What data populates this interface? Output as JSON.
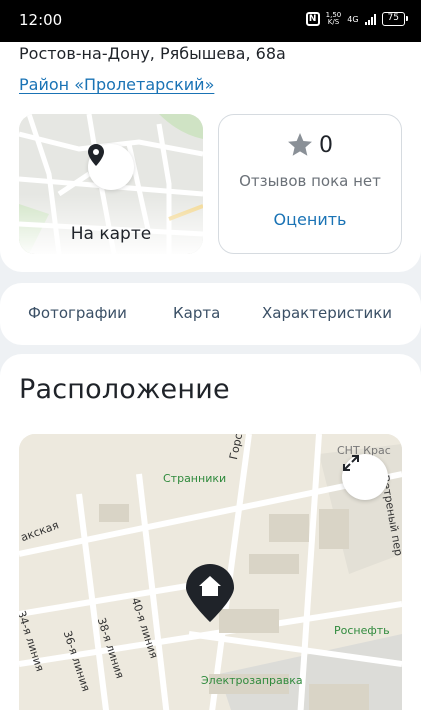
{
  "status_bar": {
    "time": "12:00",
    "speed_value": "1,50",
    "speed_unit": "K/S",
    "network": "4G",
    "battery": "75"
  },
  "listing": {
    "address": "Ростов-на-Дону, Рябышева, 68а",
    "district": "Район «Пролетарский»"
  },
  "map_preview": {
    "label": "На карте"
  },
  "reviews": {
    "count": "0",
    "empty_text": "Отзывов пока нет",
    "rate_label": "Оценить"
  },
  "tabs": [
    {
      "label": "Фотографии"
    },
    {
      "label": "Карта"
    },
    {
      "label": "Характеристики"
    }
  ],
  "location": {
    "title": "Расположение",
    "map_labels": {
      "poi_1": "Странники",
      "poi_2": "Роснефть",
      "poi_3": "Электрозаправка",
      "snt": "СНТ Крас",
      "street_gorsk": "Горсо",
      "street_vetr": "Ветреный пер",
      "street_aksk": "акская",
      "street_34": "34-я линия",
      "street_36": "36-я линия",
      "street_38": "38-я линия",
      "street_40": "40-я линия"
    }
  },
  "colors": {
    "accent": "#1a73b5",
    "poi_green": "#2f8a3c"
  }
}
